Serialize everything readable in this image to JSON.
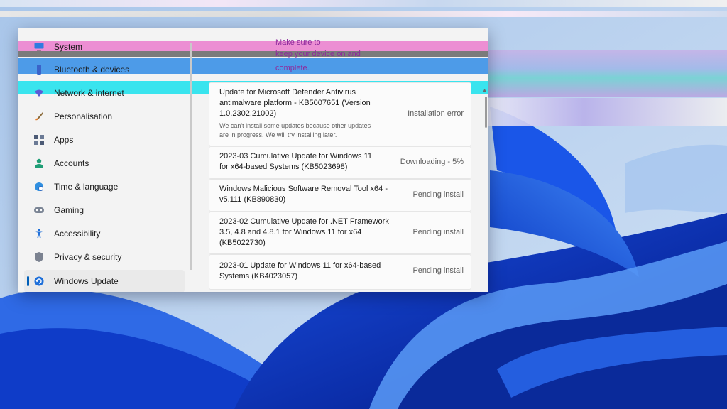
{
  "sidebar": {
    "items": [
      {
        "label": "System",
        "icon": "monitor-icon"
      },
      {
        "label": "Bluetooth & devices",
        "icon": "bluetooth-icon"
      },
      {
        "label": "Network & internet",
        "icon": "wifi-icon"
      },
      {
        "label": "Personalisation",
        "icon": "brush-icon"
      },
      {
        "label": "Apps",
        "icon": "apps-icon"
      },
      {
        "label": "Accounts",
        "icon": "person-icon"
      },
      {
        "label": "Time & language",
        "icon": "globe-clock-icon"
      },
      {
        "label": "Gaming",
        "icon": "gamepad-icon"
      },
      {
        "label": "Accessibility",
        "icon": "accessibility-icon"
      },
      {
        "label": "Privacy & security",
        "icon": "shield-icon"
      },
      {
        "label": "Windows Update",
        "icon": "update-icon",
        "active": true
      }
    ]
  },
  "header_message": {
    "line1": "Make sure to",
    "line2": "keep your device on and",
    "line3": "complete."
  },
  "updates": [
    {
      "title_lines": [
        "Update for Microsoft Defender Antivirus",
        "antimalware platform - KB5007651 (Version",
        "1.0.2302.21002)"
      ],
      "status": "Installation error",
      "note_lines": [
        "We can't install some updates because other updates",
        "are in progress. We will try installing later."
      ]
    },
    {
      "title_lines": [
        "2023-03 Cumulative Update for Windows 11",
        "for x64-based Systems (KB5023698)"
      ],
      "status": "Downloading - 5%"
    },
    {
      "title_lines": [
        "Windows Malicious Software Removal Tool x64 -",
        "v5.111 (KB890830)"
      ],
      "status": "Pending install"
    },
    {
      "title_lines": [
        "2023-02 Cumulative Update for .NET Framework",
        "3.5, 4.8 and 4.8.1 for Windows 11 for x64",
        "(KB5022730)"
      ],
      "status": "Pending install"
    },
    {
      "title_lines": [
        "2023-01 Update for Windows 11 for x64-based",
        "Systems (KB4023057)"
      ],
      "status": "Pending install"
    }
  ],
  "colors": {
    "accent": "#005fb8",
    "message": "#8e2a9c",
    "wallpaper_dark": "#0a2fb0",
    "wallpaper_light": "#b9d2f0"
  }
}
